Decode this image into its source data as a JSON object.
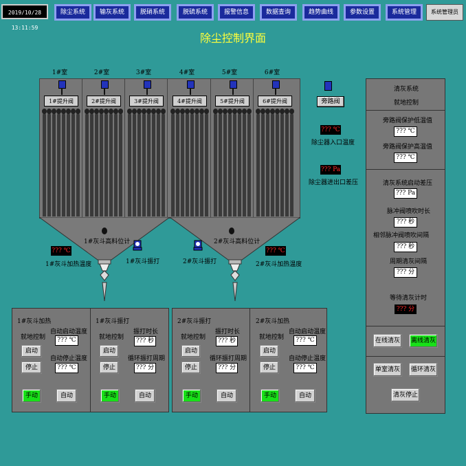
{
  "header": {
    "clock": "2019/10/28 13:11:59",
    "nav": [
      "除尘系统",
      "输灰系统",
      "脱硝系统",
      "脱硫系统",
      "报警信息",
      "数据查询",
      "趋势曲线",
      "参数设置",
      "系统管理"
    ],
    "user": "系统管理员",
    "title": "除尘控制界面"
  },
  "filter": {
    "rooms": [
      "1#室",
      "2#室",
      "3#室",
      "4#室",
      "5#室",
      "6#室"
    ],
    "lift_valves": [
      "1#提升阀",
      "2#提升阀",
      "3#提升阀",
      "4#提升阀",
      "5#提升阀",
      "6#提升阀"
    ],
    "bypass": "旁路阀",
    "inlet_temp_value": "??? ℃",
    "inlet_temp_label": "除尘器入口温度",
    "diff_pressure_value": "??? Pa",
    "diff_pressure_label": "除尘器进出口差压",
    "hopper1_level": "1#灰斗高料位计",
    "hopper2_level": "2#灰斗高料位计",
    "hopper1_heat_value": "??? ℃",
    "hopper1_heat_label": "1#灰斗加热温度",
    "hopper2_heat_value": "??? ℃",
    "hopper2_heat_label": "2#灰斗加热温度",
    "hopper1_rap": "1#灰斗振打",
    "hopper2_rap": "2#灰斗振打"
  },
  "panels": {
    "p1": {
      "title": "1#灰斗加热",
      "local": "就地控制",
      "start": "启动",
      "stop": "停止",
      "auto_start_label": "自动启动温度",
      "auto_start_value": "??? ℃",
      "auto_stop_label": "自动停止温度",
      "auto_stop_value": "??? ℃",
      "manual": "手动",
      "auto": "自动"
    },
    "p2": {
      "title": "1#灰斗振打",
      "local": "就地控制",
      "start": "启动",
      "stop": "停止",
      "rap_time_label": "振打时长",
      "rap_time_value": "??? 秒",
      "cycle_label": "循环振打周期",
      "cycle_value": "??? 分",
      "manual": "手动",
      "auto": "自动"
    },
    "p3": {
      "title": "2#灰斗振打",
      "local": "就地控制",
      "start": "启动",
      "stop": "停止",
      "rap_time_label": "振打时长",
      "rap_time_value": "??? 秒",
      "cycle_label": "循环振打周期",
      "cycle_value": "??? 分",
      "manual": "手动",
      "auto": "自动"
    },
    "p4": {
      "title": "2#灰斗加热",
      "local": "就地控制",
      "start": "启动",
      "stop": "停止",
      "auto_start_label": "自动启动温度",
      "auto_start_value": "??? ℃",
      "auto_stop_label": "自动停止温度",
      "auto_stop_value": "??? ℃",
      "manual": "手动",
      "auto": "自动"
    }
  },
  "cleaning": {
    "title1": "清灰系统",
    "title2": "就地控制",
    "bypass_low_label": "旁路阀保护低温值",
    "bypass_low_value": "??? ℃",
    "bypass_high_label": "旁路阀保护高温值",
    "bypass_high_value": "??? ℃",
    "start_diff_label": "清灰系统启动差压",
    "start_diff_value": "??? Pa",
    "pulse_time_label": "脉冲阀喷吹时长",
    "pulse_time_value": "??? 秒",
    "pulse_interval_label": "相邻脉冲阀喷吹间隔",
    "pulse_interval_value": "??? 秒",
    "cycle_label": "周期清灰间隔",
    "cycle_value": "??? 分",
    "wait_label": "等待清灰计时",
    "wait_value": "??? 分",
    "online": "在线清灰",
    "offline": "离线清灰",
    "single": "单室清灰",
    "loop": "循环清灰",
    "stop": "清灰停止"
  },
  "colors": {
    "background": "#2f9a98",
    "nav": "#1a2a9c",
    "active_green": "#18e018",
    "title": "#ffff3a"
  }
}
